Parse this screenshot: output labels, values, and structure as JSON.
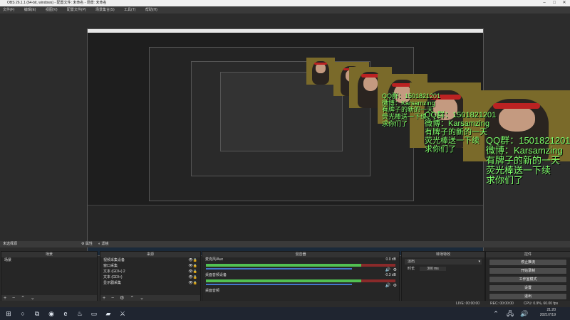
{
  "window": {
    "title": "OBS 26.1.1 (64-bit, windows) - 配置文件: 未命名 - 场景: 未命名"
  },
  "menu": [
    "文件(F)",
    "编辑(E)",
    "视图(V)",
    "配置文件(P)",
    "场景集合(S)",
    "工具(T)",
    "帮助(H)"
  ],
  "preview": {
    "overlay_text_lines": [
      "QQ群：1501821201",
      "微博：Karsamzing",
      "有牌子的新的一天",
      "荧光棒送一下续",
      "求你们了"
    ]
  },
  "scene_bar": {
    "label": "未选择源",
    "properties_button": "属性",
    "filters_button": "滤镜"
  },
  "scenes": {
    "header": "场景",
    "items": [
      "场景"
    ]
  },
  "sources": {
    "header": "来源",
    "items": [
      {
        "label": "视频采集设备"
      },
      {
        "label": "窗口采集"
      },
      {
        "label": "文本 (GDI+) 2"
      },
      {
        "label": "文本 (GDI+)"
      },
      {
        "label": "显示器采集"
      }
    ]
  },
  "mixer": {
    "header": "混音器",
    "channels": [
      {
        "name": "麦克风/Aux",
        "db": "0.0 dB",
        "level": 0.86,
        "volume": 0.78
      },
      {
        "name": "桌面音频设备",
        "db": "-0.3 dB",
        "level": 0.86,
        "volume": 0.78
      },
      {
        "name": "桌面音频",
        "db": "",
        "level": 0.0,
        "volume": 0.0
      }
    ]
  },
  "transitions": {
    "header": "转场特效",
    "type": "淡出",
    "duration_label": "时长",
    "duration_value": "300 ms"
  },
  "controls": {
    "header": "控件",
    "buttons": [
      "停止推流",
      "开始录制",
      "工作室模式",
      "设置",
      "退出"
    ]
  },
  "status": {
    "live": "LIVE: 00:00:00",
    "rec": "REC: 00:00:00",
    "cpu": "CPU: 0.9%, 60.00 fps"
  },
  "taskbar": {
    "time": "21:20",
    "date": "2021/7/19",
    "start_icon": "windows-start-icon",
    "icons": [
      "search-icon",
      "taskview-icon",
      "obs-icon",
      "edge-icon",
      "steam-icon",
      "explorer-icon",
      "folder-icon",
      "app-icon"
    ]
  }
}
